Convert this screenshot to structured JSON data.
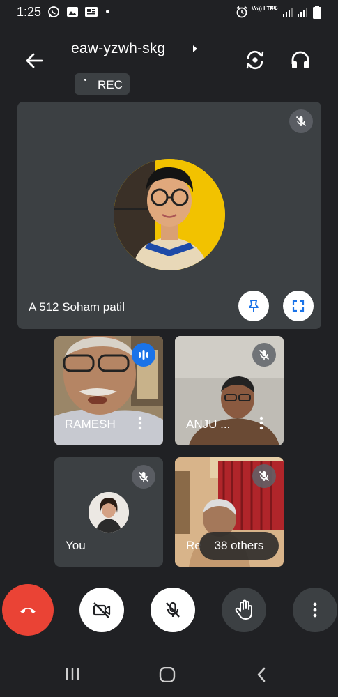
{
  "status_bar": {
    "time": "1:25",
    "carrier_label": "Vo)) LTE1",
    "network_label": "4G",
    "icons": [
      "whatsapp-icon",
      "gallery-icon",
      "notification-icon",
      "alarm-icon",
      "signal-icon",
      "battery-icon"
    ]
  },
  "header": {
    "meeting_code": "eaw-yzwh-skg",
    "recording_label": "REC",
    "icons": [
      "back-arrow-icon",
      "switch-camera-icon",
      "headphones-icon"
    ]
  },
  "main_tile": {
    "participant_name": "A 512 Soham patil",
    "muted": true
  },
  "grid": [
    {
      "participant_name": "RAMESH",
      "speaking": true,
      "muted": false
    },
    {
      "participant_name": "ANJU ...",
      "speaking": false,
      "muted": true
    },
    {
      "participant_name": "You",
      "speaking": false,
      "muted": true
    },
    {
      "participant_name": "Re",
      "speaking": false,
      "muted": true
    }
  ],
  "overflow": {
    "others_label": "38 others"
  },
  "controls": [
    "end-call-button",
    "camera-off-button",
    "mic-off-button",
    "raise-hand-button",
    "more-options-button"
  ],
  "colors": {
    "background": "#202124",
    "tile": "#3c4043",
    "end_call": "#ea4335",
    "speaking_indicator": "#1a73e8",
    "pin_icon": "#1a73e8"
  }
}
